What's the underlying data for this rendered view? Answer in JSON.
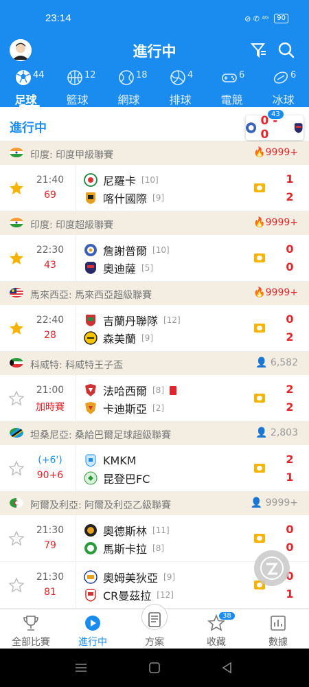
{
  "status_bar": {
    "time": "23:14",
    "icons": "⊘ ✆ ⁴ᴳ",
    "battery": "90"
  },
  "header": {
    "title": "進行中"
  },
  "sports": [
    {
      "label": "足球",
      "count": "44"
    },
    {
      "label": "籃球",
      "count": "12"
    },
    {
      "label": "網球",
      "count": "18"
    },
    {
      "label": "排球",
      "count": "4"
    },
    {
      "label": "電競",
      "count": "6"
    },
    {
      "label": "冰球",
      "count": "6"
    }
  ],
  "live": {
    "label": "進行中",
    "float_badge": "43",
    "float_score": "0 - 0"
  },
  "leagues": [
    {
      "name": "印度: 印度甲級聯賽",
      "heat": "9999+",
      "hot": true,
      "match": {
        "time": "21:40",
        "minute": "69",
        "starred": true,
        "home": {
          "name": "尼羅卡",
          "rank": "[10]"
        },
        "away": {
          "name": "喀什國際",
          "rank": "[9]"
        },
        "home_score": "1",
        "away_score": "2"
      }
    },
    {
      "name": "印度: 印度超級聯賽",
      "heat": "9999+",
      "hot": true,
      "match": {
        "time": "22:30",
        "minute": "43",
        "starred": true,
        "home": {
          "name": "詹謝普爾",
          "rank": "[10]"
        },
        "away": {
          "name": "奧迪薩",
          "rank": "[5]"
        },
        "home_score": "0",
        "away_score": "0"
      }
    },
    {
      "name": "馬來西亞: 馬來西亞超級聯賽",
      "heat": "9999+",
      "hot": true,
      "match": {
        "time": "22:40",
        "minute": "28",
        "starred": true,
        "home": {
          "name": "吉蘭丹聯隊",
          "rank": "[12]"
        },
        "away": {
          "name": "森美蘭",
          "rank": "[9]"
        },
        "home_score": "0",
        "away_score": "2"
      }
    },
    {
      "name": "科威特: 科威特王子盃",
      "heat": "6,582",
      "hot": false,
      "match": {
        "time": "21:00",
        "minute": "加時賽",
        "starred": false,
        "home": {
          "name": "法哈西爾",
          "rank": "[8]"
        },
        "away": {
          "name": "卡迪斯亞",
          "rank": "[2]"
        },
        "home_score": "2",
        "away_score": "2"
      }
    },
    {
      "name": "坦桑尼亞: 桑給巴爾足球超級聯賽",
      "heat": "2,803",
      "hot": false,
      "match": {
        "time": "(+6')",
        "minute": "90+6",
        "starred": false,
        "home": {
          "name": "KMKM",
          "rank": ""
        },
        "away": {
          "name": "昆登巴FC",
          "rank": ""
        },
        "home_score": "2",
        "away_score": "1"
      }
    },
    {
      "name": "阿爾及利亞: 阿爾及利亞乙級聯賽",
      "heat": "9999+",
      "hot": false,
      "match": {
        "time": "21:30",
        "minute": "79",
        "starred": false,
        "home": {
          "name": "奧德斯林",
          "rank": "[11]"
        },
        "away": {
          "name": "馬斯卡拉",
          "rank": "[8]"
        },
        "home_score": "0",
        "away_score": "0"
      }
    }
  ],
  "extra_match": {
    "time": "21:30",
    "minute": "81",
    "starred": false,
    "home": {
      "name": "奧姆美狄亞",
      "rank": "[9]"
    },
    "away": {
      "name": "CR曼茲拉",
      "rank": "[12]"
    },
    "home_score": "0",
    "away_score": "1"
  },
  "bottom_nav": [
    {
      "label": "全部比賽"
    },
    {
      "label": "進行中"
    },
    {
      "label": "方案"
    },
    {
      "label": "收藏",
      "badge": "38"
    },
    {
      "label": "數據"
    }
  ],
  "colors": {
    "primary": "#1a8cf0",
    "score_red": "#e0262b",
    "league_bg": "#f4eee2",
    "star_gold": "#f6b400"
  }
}
